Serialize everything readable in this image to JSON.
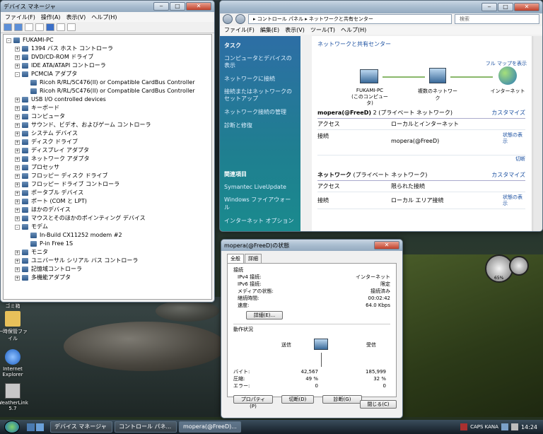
{
  "device_manager": {
    "title": "デバイス マネージャ",
    "menu": [
      "ファイル(F)",
      "操作(A)",
      "表示(V)",
      "ヘルプ(H)"
    ],
    "tree": [
      {
        "label": "FUKAMI-PC",
        "level": 0,
        "exp": "-"
      },
      {
        "label": "1394 バス ホスト コントローラ",
        "level": 1,
        "exp": "+"
      },
      {
        "label": "DVD/CD-ROM ドライブ",
        "level": 1,
        "exp": "+"
      },
      {
        "label": "IDE ATA/ATAPI コントローラ",
        "level": 1,
        "exp": "+"
      },
      {
        "label": "PCMCIA アダプタ",
        "level": 1,
        "exp": "-"
      },
      {
        "label": "Ricoh R/RL/5C476(II) or Compatible CardBus Controller",
        "level": 2,
        "exp": ""
      },
      {
        "label": "Ricoh R/RL/5C476(II) or Compatible CardBus Controller",
        "level": 2,
        "exp": ""
      },
      {
        "label": "USB I/O controlled devices",
        "level": 1,
        "exp": "+"
      },
      {
        "label": "キーボード",
        "level": 1,
        "exp": "+"
      },
      {
        "label": "コンピュータ",
        "level": 1,
        "exp": "+"
      },
      {
        "label": "サウンド、ビデオ、およびゲーム コントローラ",
        "level": 1,
        "exp": "+"
      },
      {
        "label": "システム デバイス",
        "level": 1,
        "exp": "+"
      },
      {
        "label": "ディスク ドライブ",
        "level": 1,
        "exp": "+"
      },
      {
        "label": "ディスプレイ アダプタ",
        "level": 1,
        "exp": "+"
      },
      {
        "label": "ネットワーク アダプタ",
        "level": 1,
        "exp": "+"
      },
      {
        "label": "プロセッサ",
        "level": 1,
        "exp": "+"
      },
      {
        "label": "フロッピー ディスク ドライブ",
        "level": 1,
        "exp": "+"
      },
      {
        "label": "フロッピー ドライブ コントローラ",
        "level": 1,
        "exp": "+"
      },
      {
        "label": "ポータブル デバイス",
        "level": 1,
        "exp": "+"
      },
      {
        "label": "ポート (COM と LPT)",
        "level": 1,
        "exp": "+"
      },
      {
        "label": "ほかのデバイス",
        "level": 1,
        "exp": "+"
      },
      {
        "label": "マウスとそのほかのポインティング デバイス",
        "level": 1,
        "exp": "+"
      },
      {
        "label": "モデム",
        "level": 1,
        "exp": "-"
      },
      {
        "label": "In-Build CX11252 modem #2",
        "level": 2,
        "exp": ""
      },
      {
        "label": "P-in Free 1S",
        "level": 2,
        "exp": ""
      },
      {
        "label": "モニタ",
        "level": 1,
        "exp": "+"
      },
      {
        "label": "ユニバーサル シリアル バス コントローラ",
        "level": 1,
        "exp": "+"
      },
      {
        "label": "記憶域コントローラ",
        "level": 1,
        "exp": "+"
      },
      {
        "label": "多機能アダプタ",
        "level": 1,
        "exp": "+"
      }
    ]
  },
  "network_center": {
    "breadcrumb": "▸ コントロール パネル ▸ ネットワークと共有センター",
    "search_placeholder": "検索",
    "menu": [
      "ファイル(F)",
      "編集(E)",
      "表示(V)",
      "ツール(T)",
      "ヘルプ(H)"
    ],
    "tasks_heading": "タスク",
    "tasks": [
      "コンピュータとデバイスの表示",
      "ネットワークに接続",
      "接続またはネットワークのセットアップ",
      "ネットワーク接続の管理",
      "診断と修復"
    ],
    "related_heading": "関連項目",
    "related": [
      "Symantec LiveUpdate",
      "Windows ファイアウォール",
      "インターネット オプション"
    ],
    "page_title": "ネットワークと共有センター",
    "full_map": "フル マップを表示",
    "map": {
      "pc": "FUKAMI-PC",
      "pc_sub": "(このコンピュータ)",
      "multi": "複数のネットワーク",
      "internet": "インターネット"
    },
    "networks": [
      {
        "name": "mopera(@FreeD)",
        "suffix": "2 (プライベート ネットワーク)",
        "customize": "カスタマイズ",
        "access_label": "アクセス",
        "access_value": "ローカルとインターネット",
        "conn_label": "接続",
        "conn_value": "mopera(@FreeD)",
        "status_link": "状態の表示",
        "disconnect": "切断"
      },
      {
        "name": "ネットワーク",
        "suffix": "(プライベート ネットワーク)",
        "customize": "カスタマイズ",
        "access_label": "アクセス",
        "access_value": "限られた接続",
        "conn_label": "接続",
        "conn_value": "ローカル エリア接続",
        "status_link": "状態の表示"
      }
    ]
  },
  "status_dialog": {
    "title": "mopera(@FreeD)の状態",
    "tabs": [
      "全般",
      "詳細"
    ],
    "connection_heading": "接続",
    "rows": [
      {
        "label": "IPv4 接続:",
        "value": "インターネット"
      },
      {
        "label": "IPv6 接続:",
        "value": "限定"
      },
      {
        "label": "メディアの状態:",
        "value": "接続済み"
      },
      {
        "label": "継続時間:",
        "value": "00:02:42"
      },
      {
        "label": "速度:",
        "value": "64.0 Kbps"
      }
    ],
    "details_button": "詳細(E)...",
    "activity_heading": "動作状況",
    "sent_label": "送信",
    "recv_label": "受信",
    "stats": [
      {
        "label": "バイト:",
        "sent": "42,567",
        "recv": "185,999"
      },
      {
        "label": "圧縮:",
        "sent": "49 %",
        "recv": "32 %"
      },
      {
        "label": "エラー:",
        "sent": "0",
        "recv": "0"
      }
    ],
    "buttons": [
      "プロパティ(P)",
      "切断(D)",
      "診断(G)"
    ],
    "close_button": "閉じる(C)"
  },
  "desktop_icons": [
    {
      "label": "ゴミ箱",
      "color": "#8aa4bd"
    },
    {
      "label": "一時保管ファイル",
      "color": "#e8c05a"
    },
    {
      "label": "Internet Explorer",
      "color": "#3a7ad8"
    },
    {
      "label": "WeatherLink 5.7",
      "color": "#c8c8c8"
    }
  ],
  "gadget": {
    "value": "65%"
  },
  "taskbar": {
    "tasks": [
      "デバイス マネージャ",
      "コントロール パネ...",
      "mopera(@FreeD)..."
    ],
    "clock": "14:24",
    "tray_text": "CAPS KANA"
  }
}
